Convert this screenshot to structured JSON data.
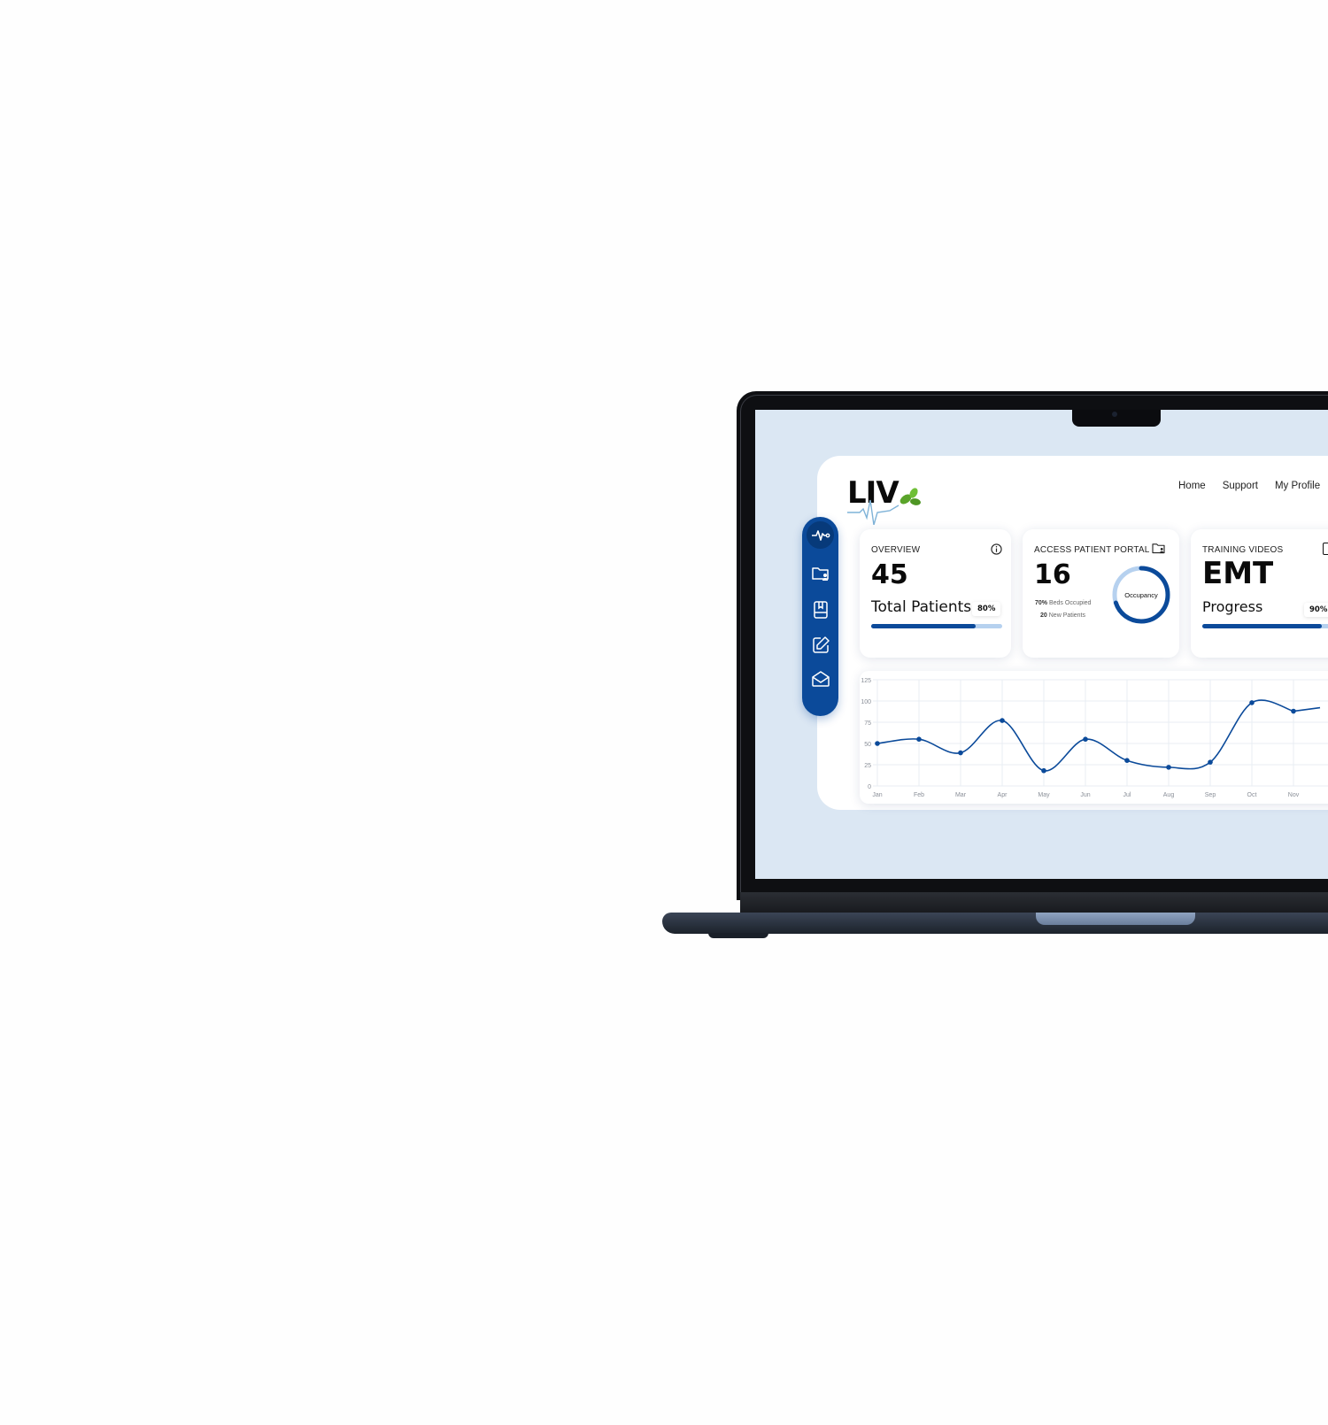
{
  "brand": {
    "logo_text": "LIV",
    "accent": "#0b4a9a",
    "accent_light": "#b6d1ef",
    "leaf": "#5aa42a"
  },
  "nav": {
    "home": "Home",
    "support": "Support",
    "profile": "My Profile"
  },
  "sidebar": [
    {
      "name": "heartbeat-icon",
      "active": true
    },
    {
      "name": "patient-folder-icon",
      "active": false
    },
    {
      "name": "book-icon",
      "active": false
    },
    {
      "name": "edit-icon",
      "active": false
    },
    {
      "name": "mail-icon",
      "active": false
    }
  ],
  "cards": {
    "overview": {
      "title": "OVERVIEW",
      "value": "45",
      "label": "Total Patients",
      "percent_label": "80%",
      "progress": 0.8
    },
    "portal": {
      "title": "ACCESS PATIENT PORTAL",
      "value": "16",
      "beds_value": "70%",
      "beds_label": "Beds Occupied",
      "new_value": "20",
      "new_label": "New Patients",
      "donut_label": "Occupancy",
      "occupancy": 0.7
    },
    "training": {
      "title": "TRAINING VIDEOS",
      "value": "EMT",
      "label": "Progress",
      "percent_label": "90%",
      "progress": 0.9
    }
  },
  "chart_data": {
    "type": "line",
    "categories": [
      "Jan",
      "Feb",
      "Mar",
      "Apr",
      "May",
      "Jun",
      "Jul",
      "Aug",
      "Sep",
      "Oct",
      "Nov"
    ],
    "values": [
      50,
      55,
      39,
      77,
      18,
      55,
      30,
      22,
      28,
      98,
      88
    ],
    "yticks": [
      0,
      25,
      50,
      75,
      100,
      125
    ],
    "ylim": [
      0,
      125
    ],
    "grid": true,
    "color": "#0b4a9a"
  }
}
